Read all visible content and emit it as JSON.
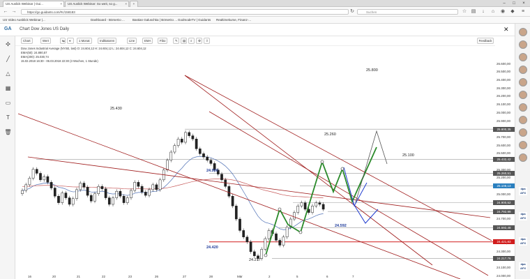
{
  "browser": {
    "tabs": [
      {
        "label": "US Auslick Webinar | Gui..."
      },
      {
        "label": "US Auslick Webinar: So weit, so g..."
      }
    ],
    "url": "https://go.guidants.com/#c/158183",
    "search_placeholder": "Suchen",
    "bookmarks": [
      "US Video Ausblick Webinar |...",
      "Dashboard - BörseGo ...",
      "Bastian Galuschka | BörseGo ...",
      "GodmodeTV | Guidants",
      "Realtimekurse, Finanz-..."
    ]
  },
  "app": {
    "logo": "GA",
    "title": "Chart Dow Jones US Daily",
    "close": "✕",
    "toolbar": [
      "Chart",
      "Wert",
      "1 Monat",
      "Indikatoren",
      "Line",
      "EMA",
      "Fibo"
    ],
    "feedback": "Feedback"
  },
  "legend": {
    "line1": "Dow Jones Industrial Average (NYSE, last)  O: 24.604,12  H: 24.604,12  L: 24.604,12  C: 24.604,12",
    "line2": "EMA(50): 24.880,57",
    "line3": "EMA(200): 25.030,74",
    "line4": "15.02.2018 16:30 - 06.03.2018 22:30  (3 Wochen, 1 Stunde)"
  },
  "chart_data": {
    "type": "candlestick",
    "ylim": [
      24000,
      26750
    ],
    "price_labels": [
      {
        "text": "25.800,35",
        "value": 25800,
        "color": "#555555"
      },
      {
        "text": "25.432,42",
        "value": 25432,
        "color": "#555555"
      },
      {
        "text": "25.260,51",
        "value": 25260,
        "color": "#555555"
      },
      {
        "text": "25.108,13",
        "value": 25108,
        "color": "#2a7fbf"
      },
      {
        "text": "24.900,52",
        "value": 24900,
        "color": "#555555"
      },
      {
        "text": "24.792,99",
        "value": 24793,
        "color": "#555555"
      },
      {
        "text": "24.592,48",
        "value": 24592,
        "color": "#555555"
      },
      {
        "text": "24.421,83",
        "value": 24421,
        "color": "#d11c1c"
      },
      {
        "text": "24.217,76",
        "value": 24217,
        "color": "#555555"
      }
    ],
    "axis_ticks": [
      "26.600,00",
      "26.500,00",
      "26.400,00",
      "26.300,00",
      "26.200,00",
      "26.100,00",
      "26.000,00",
      "25.900,00",
      "25.700,00",
      "25.600,00",
      "25.500,00",
      "25.300,00",
      "25.200,00",
      "25.000,00",
      "24.800,00",
      "24.700,00",
      "24.600,00",
      "24.400,00",
      "24.300,00",
      "24.100,00",
      "24.000,00"
    ],
    "annotations": [
      {
        "text": "25.800",
        "color": "dark"
      },
      {
        "text": "25.430",
        "color": "dark"
      },
      {
        "text": "25.260",
        "color": "dark"
      },
      {
        "text": "25.100",
        "color": "dark"
      },
      {
        "text": "24.900",
        "color": "blue"
      },
      {
        "text": "24.592",
        "color": "blue"
      },
      {
        "text": "24.420",
        "color": "blue"
      },
      {
        "text": "24.217",
        "color": "dark"
      }
    ],
    "x_ticks": [
      "16",
      "20",
      "21",
      "22",
      "23",
      "26",
      "27",
      "28",
      "Mär",
      "2",
      "5",
      "6",
      "7"
    ]
  },
  "colors": {
    "accent": "#2a7fbf",
    "support_red": "#d11c1c",
    "trend": "#a01c1c",
    "green_path": "#2a8a2a",
    "blue_path": "#1f3bcf"
  }
}
